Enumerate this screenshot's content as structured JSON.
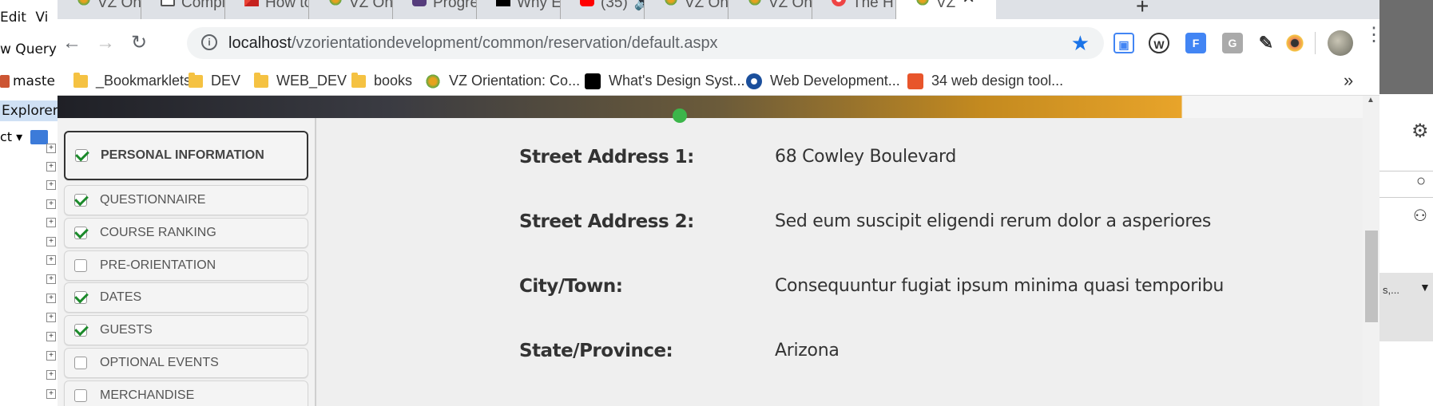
{
  "background_app": {
    "menu": [
      "Edit",
      "Vi"
    ],
    "row2": "w Query",
    "row3": "maste",
    "explorer": "Explorer",
    "row5": "ct ▾",
    "right_item": "s,..."
  },
  "tabs": [
    {
      "label": "VZ One"
    },
    {
      "label": "Compi"
    },
    {
      "label": "How to"
    },
    {
      "label": "VZ One"
    },
    {
      "label": "Progres"
    },
    {
      "label": "Why Ev"
    },
    {
      "label": "(35)"
    },
    {
      "label": "VZ One"
    },
    {
      "label": "VZ One"
    },
    {
      "label": "The H"
    },
    {
      "label": "VZ"
    }
  ],
  "toolbar": {
    "url_host": "localhost",
    "url_path": "/vzorientationdevelopment/common/reservation/default.aspx"
  },
  "bookmarks": [
    {
      "label": "_Bookmarklets",
      "icon": "folder"
    },
    {
      "label": "DEV",
      "icon": "folder"
    },
    {
      "label": "WEB_DEV",
      "icon": "folder"
    },
    {
      "label": "books",
      "icon": "folder"
    },
    {
      "label": "VZ Orientation: Co...",
      "icon": "vz-logo"
    },
    {
      "label": "What's Design Syst...",
      "icon": "dev-logo"
    },
    {
      "label": "Web Development...",
      "icon": "gear-logo"
    },
    {
      "label": "34 web design tool...",
      "icon": "cb-logo"
    }
  ],
  "steps": [
    {
      "label": "PERSONAL INFORMATION",
      "checked": true,
      "active": true
    },
    {
      "label": "QUESTIONNAIRE",
      "checked": true
    },
    {
      "label": "COURSE RANKING",
      "checked": true
    },
    {
      "label": "PRE-ORIENTATION",
      "checked": false
    },
    {
      "label": "DATES",
      "checked": true
    },
    {
      "label": "GUESTS",
      "checked": true
    },
    {
      "label": "OPTIONAL EVENTS",
      "checked": false
    },
    {
      "label": "MERCHANDISE",
      "checked": false
    }
  ],
  "fields": [
    {
      "label": "Street Address 1:",
      "value": "68 Cowley Boulevard"
    },
    {
      "label": "Street Address 2:",
      "value": "Sed eum suscipit eligendi rerum dolor a asperiores"
    },
    {
      "label": "City/Town:",
      "value": "Consequuntur fugiat ipsum minima quasi temporibu"
    },
    {
      "label": "State/Province:",
      "value": "Arizona"
    }
  ],
  "colors": {
    "accent": "#1a73e8",
    "check": "#1c8a2b",
    "banner_orange": "#e8a42a"
  }
}
